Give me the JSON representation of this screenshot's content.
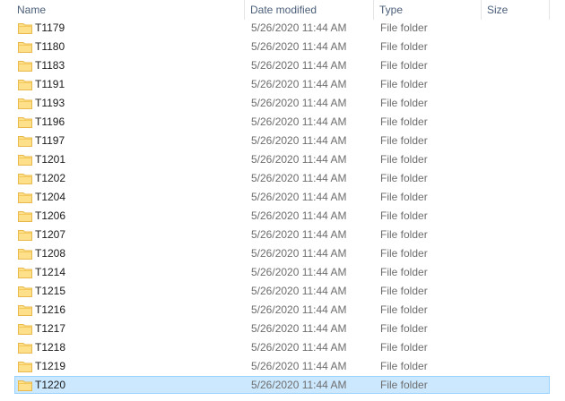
{
  "columns": {
    "name": "Name",
    "date_modified": "Date modified",
    "type": "Type",
    "size": "Size"
  },
  "sort_indicator": "^",
  "rows": [
    {
      "name": "T1179",
      "date": "5/26/2020 11:44 AM",
      "type": "File folder",
      "size": ""
    },
    {
      "name": "T1180",
      "date": "5/26/2020 11:44 AM",
      "type": "File folder",
      "size": ""
    },
    {
      "name": "T1183",
      "date": "5/26/2020 11:44 AM",
      "type": "File folder",
      "size": ""
    },
    {
      "name": "T1191",
      "date": "5/26/2020 11:44 AM",
      "type": "File folder",
      "size": ""
    },
    {
      "name": "T1193",
      "date": "5/26/2020 11:44 AM",
      "type": "File folder",
      "size": ""
    },
    {
      "name": "T1196",
      "date": "5/26/2020 11:44 AM",
      "type": "File folder",
      "size": ""
    },
    {
      "name": "T1197",
      "date": "5/26/2020 11:44 AM",
      "type": "File folder",
      "size": ""
    },
    {
      "name": "T1201",
      "date": "5/26/2020 11:44 AM",
      "type": "File folder",
      "size": ""
    },
    {
      "name": "T1202",
      "date": "5/26/2020 11:44 AM",
      "type": "File folder",
      "size": ""
    },
    {
      "name": "T1204",
      "date": "5/26/2020 11:44 AM",
      "type": "File folder",
      "size": ""
    },
    {
      "name": "T1206",
      "date": "5/26/2020 11:44 AM",
      "type": "File folder",
      "size": ""
    },
    {
      "name": "T1207",
      "date": "5/26/2020 11:44 AM",
      "type": "File folder",
      "size": ""
    },
    {
      "name": "T1208",
      "date": "5/26/2020 11:44 AM",
      "type": "File folder",
      "size": ""
    },
    {
      "name": "T1214",
      "date": "5/26/2020 11:44 AM",
      "type": "File folder",
      "size": ""
    },
    {
      "name": "T1215",
      "date": "5/26/2020 11:44 AM",
      "type": "File folder",
      "size": ""
    },
    {
      "name": "T1216",
      "date": "5/26/2020 11:44 AM",
      "type": "File folder",
      "size": ""
    },
    {
      "name": "T1217",
      "date": "5/26/2020 11:44 AM",
      "type": "File folder",
      "size": ""
    },
    {
      "name": "T1218",
      "date": "5/26/2020 11:44 AM",
      "type": "File folder",
      "size": ""
    },
    {
      "name": "T1219",
      "date": "5/26/2020 11:44 AM",
      "type": "File folder",
      "size": ""
    },
    {
      "name": "T1220",
      "date": "5/26/2020 11:44 AM",
      "type": "File folder",
      "size": "",
      "selected": true
    }
  ],
  "icons": {
    "folder": "folder-icon"
  },
  "colors": {
    "header_text": "#4c607a",
    "selection_fill": "#cce8ff",
    "selection_border": "#99d1ff",
    "folder_fill": "#ffe08a",
    "folder_tab": "#e8b84a"
  }
}
